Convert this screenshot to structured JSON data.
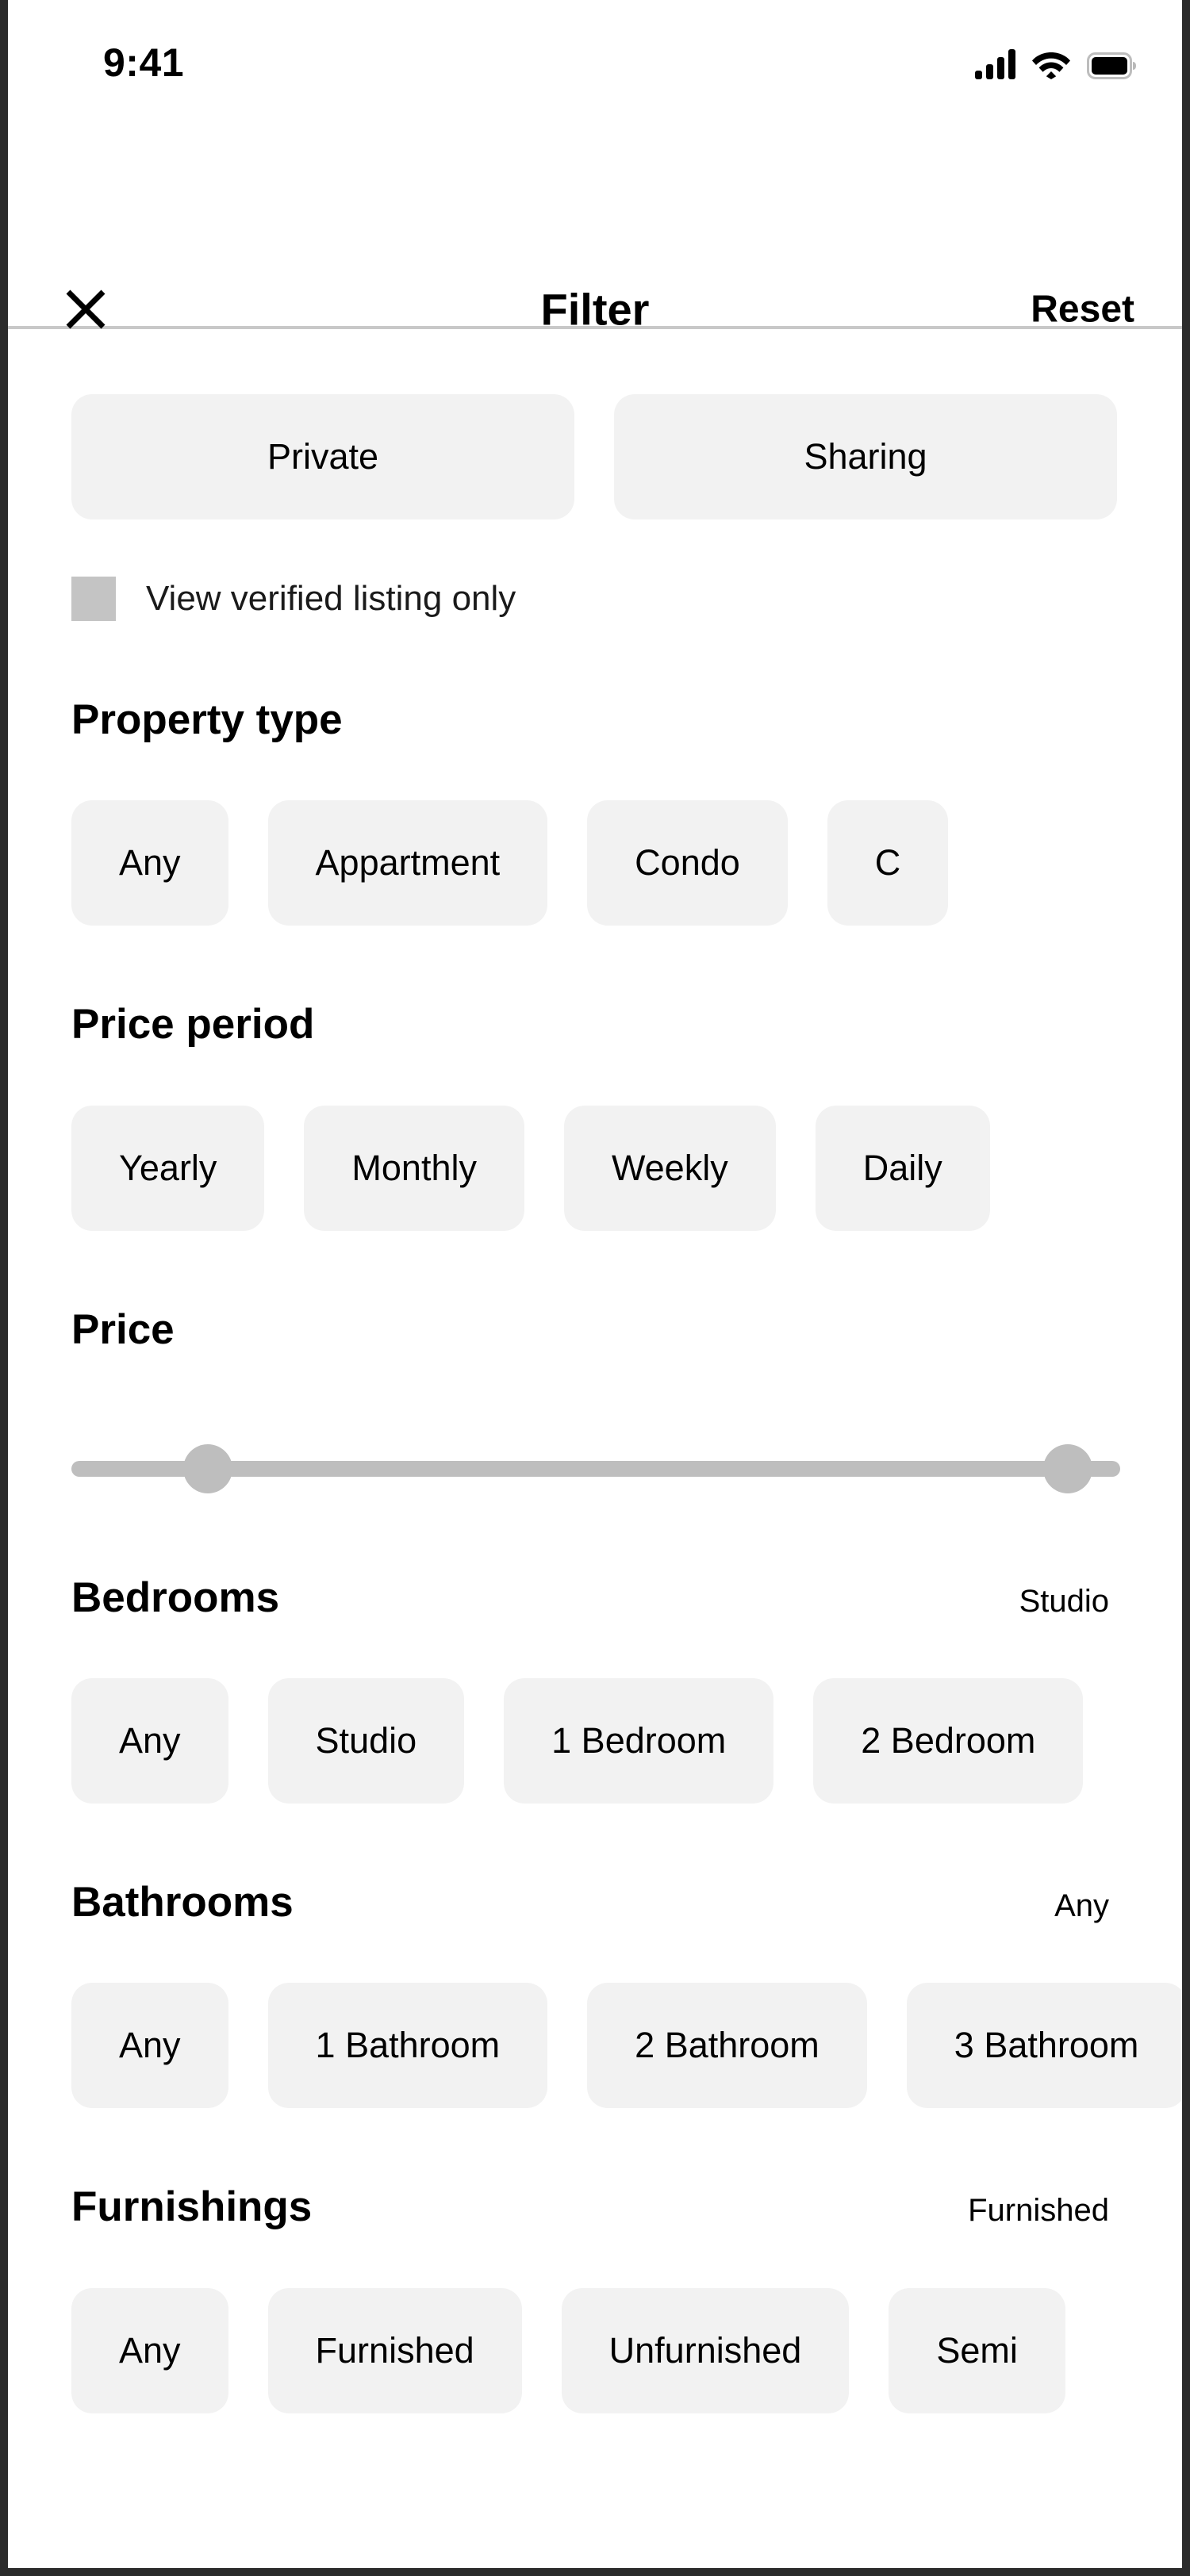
{
  "status_bar": {
    "time": "9:41",
    "icons": [
      "cellular-signal-icon",
      "wifi-icon",
      "battery-full-icon"
    ]
  },
  "header": {
    "close_icon": "close-icon",
    "title": "Filter",
    "reset_label": "Reset"
  },
  "listing_type": {
    "options": [
      "Private",
      "Sharing"
    ]
  },
  "verified": {
    "label": "View verified listing only",
    "checked": false,
    "checkbox_color": "#c4c4c4"
  },
  "property_type": {
    "title": "Property type",
    "options": [
      "Any",
      "Appartment",
      "Condo",
      "C"
    ]
  },
  "price_period": {
    "title": "Price period",
    "options": [
      "Yearly",
      "Monthly",
      "Weekly",
      "Daily"
    ]
  },
  "price": {
    "title": "Price",
    "min_thumb_percent": 13,
    "max_thumb_percent": 95,
    "track_color": "#bebebe"
  },
  "bedrooms": {
    "title": "Bedrooms",
    "value": "Studio",
    "options": [
      "Any",
      "Studio",
      "1 Bedroom",
      "2 Bedroom"
    ]
  },
  "bathrooms": {
    "title": "Bathrooms",
    "value": "Any",
    "options": [
      "Any",
      "1 Bathroom",
      "2 Bathroom",
      "3 Bathroom"
    ]
  },
  "furnishings": {
    "title": "Furnishings",
    "value": "Furnished",
    "options": [
      "Any",
      "Furnished",
      "Unfurnished",
      "Semi"
    ]
  },
  "theme": {
    "chip_bg": "#f2f2f2",
    "screen_bg": "#ffffff",
    "frame_color": "#2b2b2b",
    "divider": "#c8c8c8",
    "text": "#000000"
  }
}
